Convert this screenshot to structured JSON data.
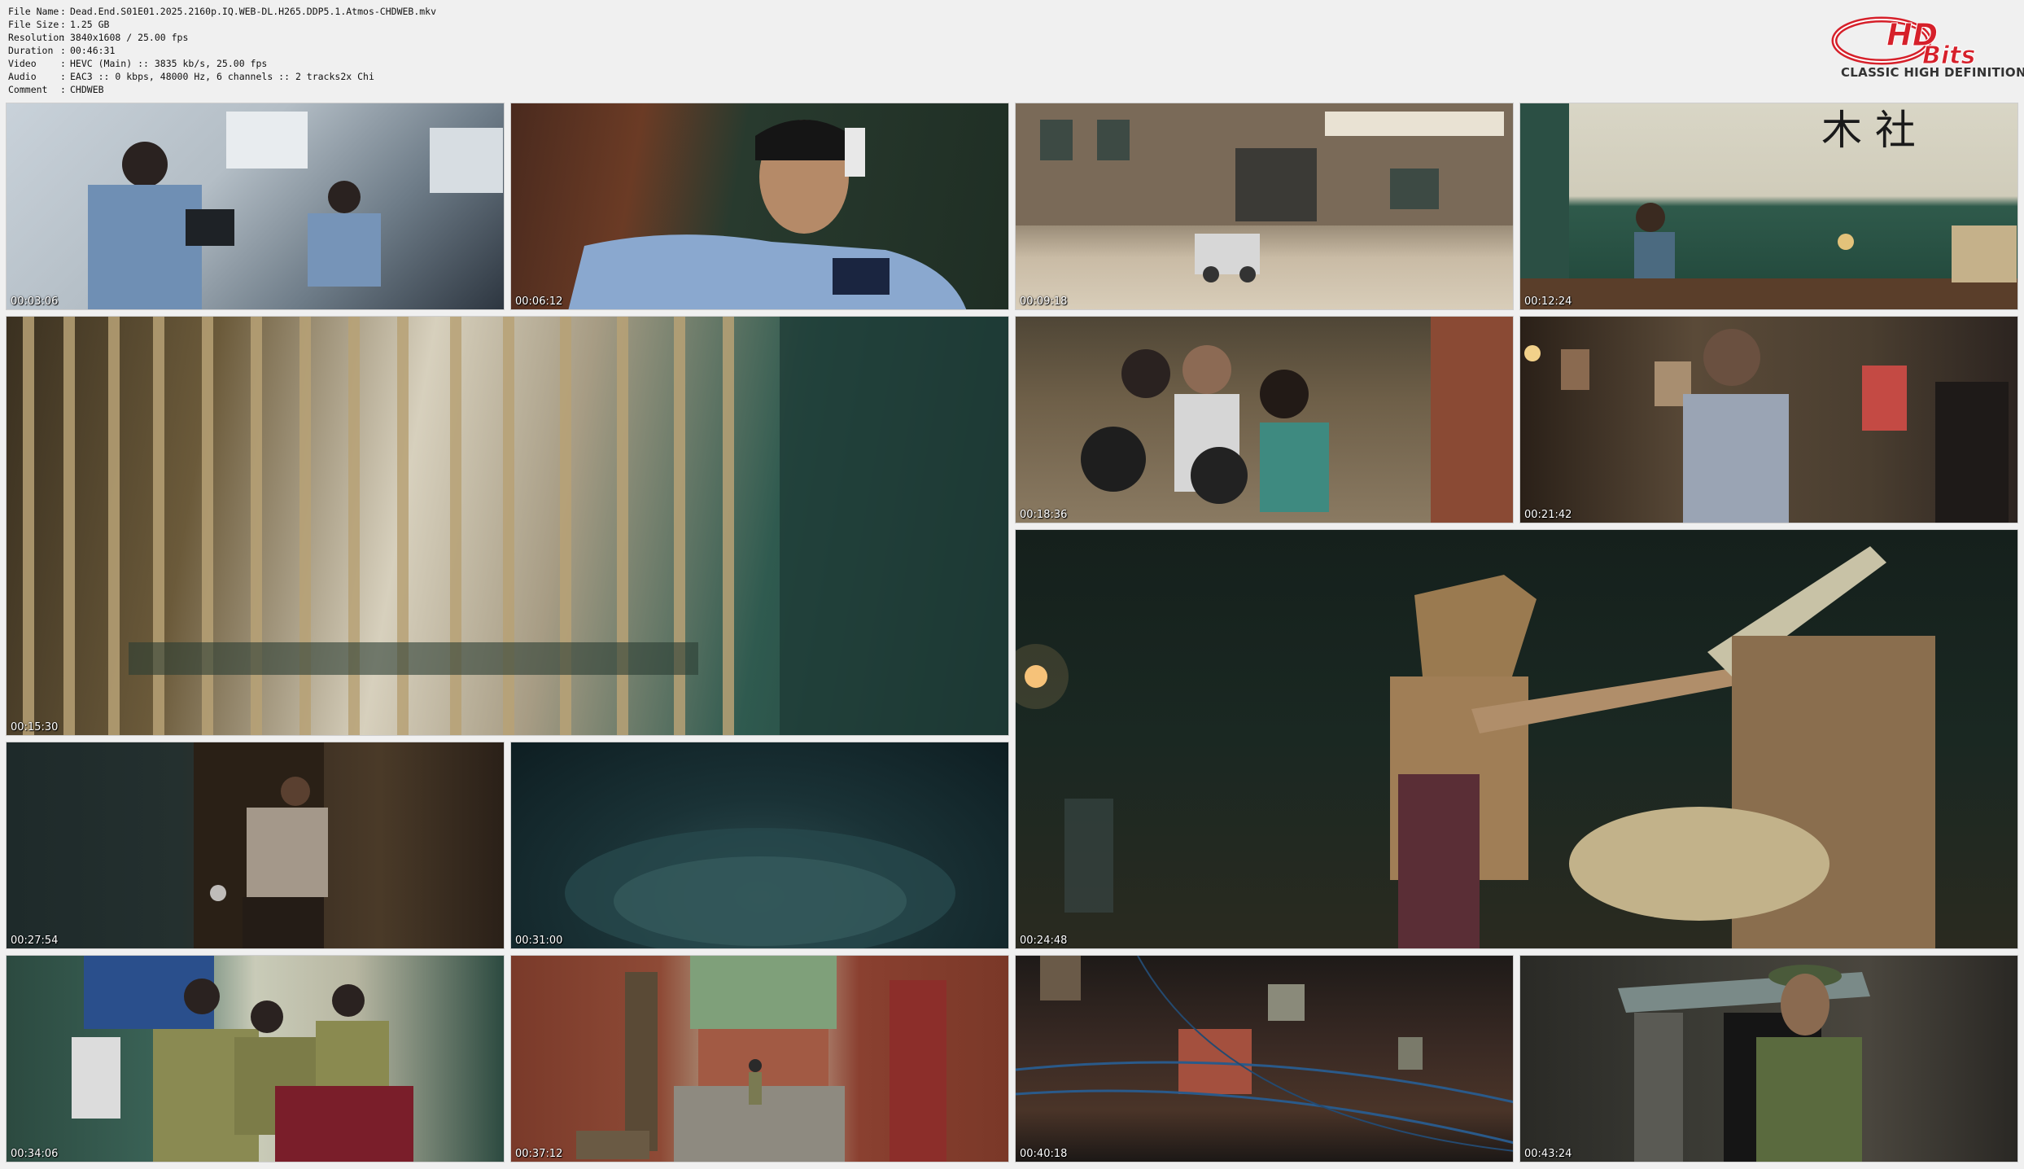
{
  "media_info": {
    "rows": [
      {
        "key": "File Name",
        "value": "Dead.End.S01E01.2025.2160p.IQ.WEB-DL.H265.DDP5.1.Atmos-CHDWEB.mkv"
      },
      {
        "key": "File Size",
        "value": "1.25 GB"
      },
      {
        "key": "Resolution",
        "value": "3840x1608 / 25.00 fps"
      },
      {
        "key": "Duration",
        "value": "00:46:31"
      },
      {
        "key": "Video",
        "value": "HEVC (Main) :: 3835 kb/s, 25.00 fps"
      },
      {
        "key": "Audio",
        "value": "EAC3 :: 0 kbps, 48000 Hz, 6 channels :: 2 tracks2x Chi"
      },
      {
        "key": "Comment",
        "value": "CHDWEB"
      }
    ]
  },
  "logo": {
    "brand": "HDBits",
    "tagline": "CLASSIC HIGH DEFINITION",
    "color": "#d6202a"
  },
  "thumbnails": [
    {
      "timestamp": "00:03:06",
      "desc": "police-office"
    },
    {
      "timestamp": "00:06:12",
      "desc": "officer-closeup"
    },
    {
      "timestamp": "00:09:18",
      "desc": "police-station-exterior"
    },
    {
      "timestamp": "00:12:24",
      "desc": "green-room-desk"
    },
    {
      "timestamp": "00:15:30",
      "desc": "bead-curtain"
    },
    {
      "timestamp": "00:18:36",
      "desc": "crowd-alley"
    },
    {
      "timestamp": "00:21:42",
      "desc": "interior-man"
    },
    {
      "timestamp": "00:24:48",
      "desc": "cardboard-costume-kids"
    },
    {
      "timestamp": "00:27:54",
      "desc": "dark-doorway"
    },
    {
      "timestamp": "00:31:00",
      "desc": "water-basin"
    },
    {
      "timestamp": "00:34:06",
      "desc": "officers-at-table"
    },
    {
      "timestamp": "00:37:12",
      "desc": "brick-alley"
    },
    {
      "timestamp": "00:40:18",
      "desc": "brick-building-night"
    },
    {
      "timestamp": "00:43:24",
      "desc": "officer-in-cap"
    }
  ]
}
